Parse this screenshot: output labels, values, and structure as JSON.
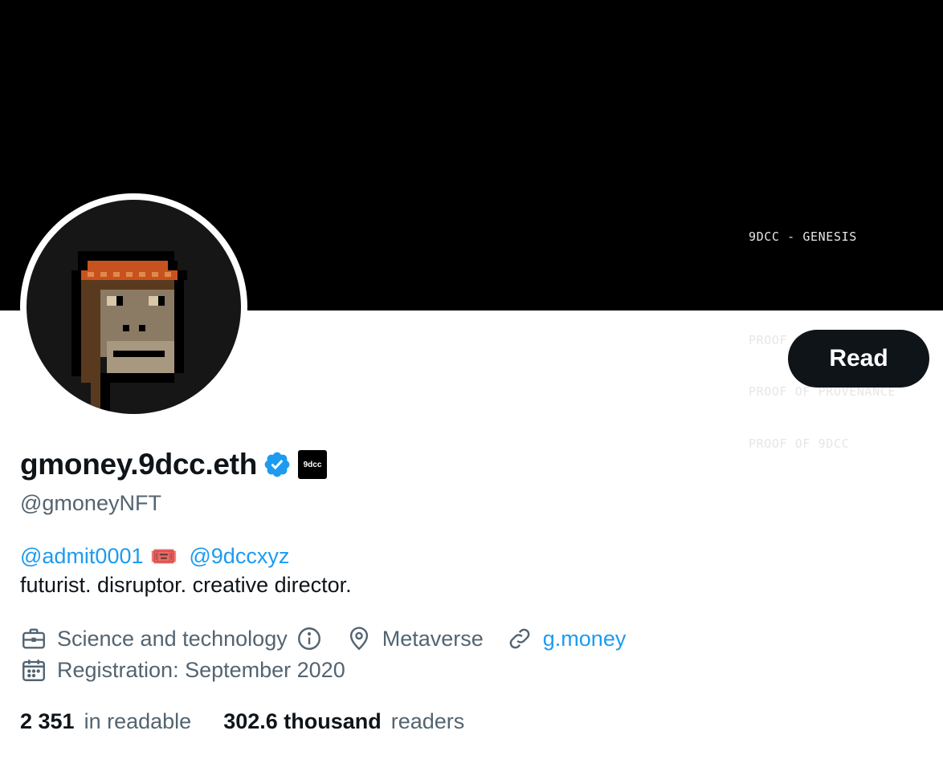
{
  "banner": {
    "line1": "9DCC - GENESIS",
    "line2": "PROOF OF ORIGINALITY",
    "line3": "PROOF OF PROVENANCE",
    "line4": "PROOF OF 9DCC"
  },
  "profile": {
    "display_name": "gmoney.9dcc.eth",
    "handle": "@gmoneyNFT",
    "badge_label": "9dcc",
    "verified_color": "#1d9bf0"
  },
  "actions": {
    "read_label": "Read"
  },
  "bio": {
    "mention1": "@admit0001",
    "ticket_emoji": "🎟️",
    "mention2": "@9dccxyz",
    "text": "futurist. disruptor. creative director."
  },
  "meta": {
    "category": "Science and technology",
    "location": "Metaverse",
    "website": "g.money",
    "registration": "Registration: September 2020"
  },
  "stats": {
    "following_count": "2 351",
    "following_label": "in readable",
    "followers_count": "302.6 thousand",
    "followers_label": "readers"
  },
  "colors": {
    "link": "#1d9bf0",
    "secondary_text": "#536471",
    "primary_text": "#0f1419",
    "button_bg": "#0f1419"
  },
  "icons": [
    "briefcase-icon",
    "info-icon",
    "location-pin-icon",
    "link-icon",
    "calendar-icon",
    "verified-icon",
    "ticket-icon"
  ]
}
